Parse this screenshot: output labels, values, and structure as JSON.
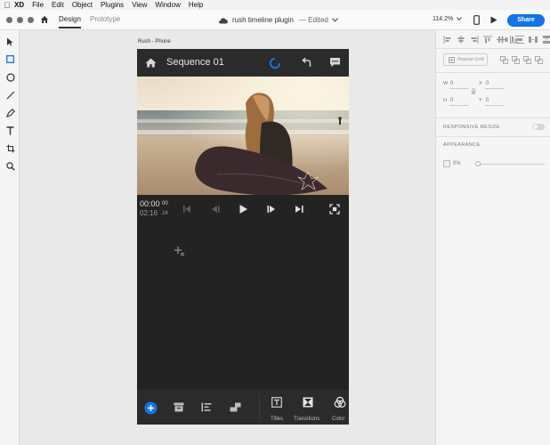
{
  "menubar": {
    "app": "XD",
    "items": [
      "File",
      "Edit",
      "Object",
      "Plugins",
      "View",
      "Window",
      "Help"
    ]
  },
  "titlebar": {
    "tabs": [
      "Design",
      "Prototype"
    ],
    "document_title": "rush timeline plugin",
    "status": "— Edited",
    "zoom": "114.2%",
    "share_label": "Share"
  },
  "canvas": {
    "artboard_label": "Rush - Phone"
  },
  "phone": {
    "sequence_title": "Sequence 01",
    "timecode_current": "00:00",
    "timecode_current_frames": "00",
    "timecode_duration": "02:16",
    "timecode_duration_frames": "24",
    "bottom_labels": [
      "Titles",
      "Transitions",
      "Color"
    ]
  },
  "properties": {
    "repeat_grid_label": "Repeat Grid",
    "w_label": "W",
    "w_value": "0",
    "h_label": "H",
    "h_value": "0",
    "x_label": "X",
    "x_value": "0",
    "y_label": "Y",
    "y_value": "0",
    "responsive_resize_label": "RESPONSIVE RESIZE",
    "appearance_label": "APPEARANCE",
    "opacity_value": "0%"
  },
  "colors": {
    "accent": "#1473e6",
    "phone_bg": "#232323",
    "phone_header": "#2b2b2b"
  }
}
